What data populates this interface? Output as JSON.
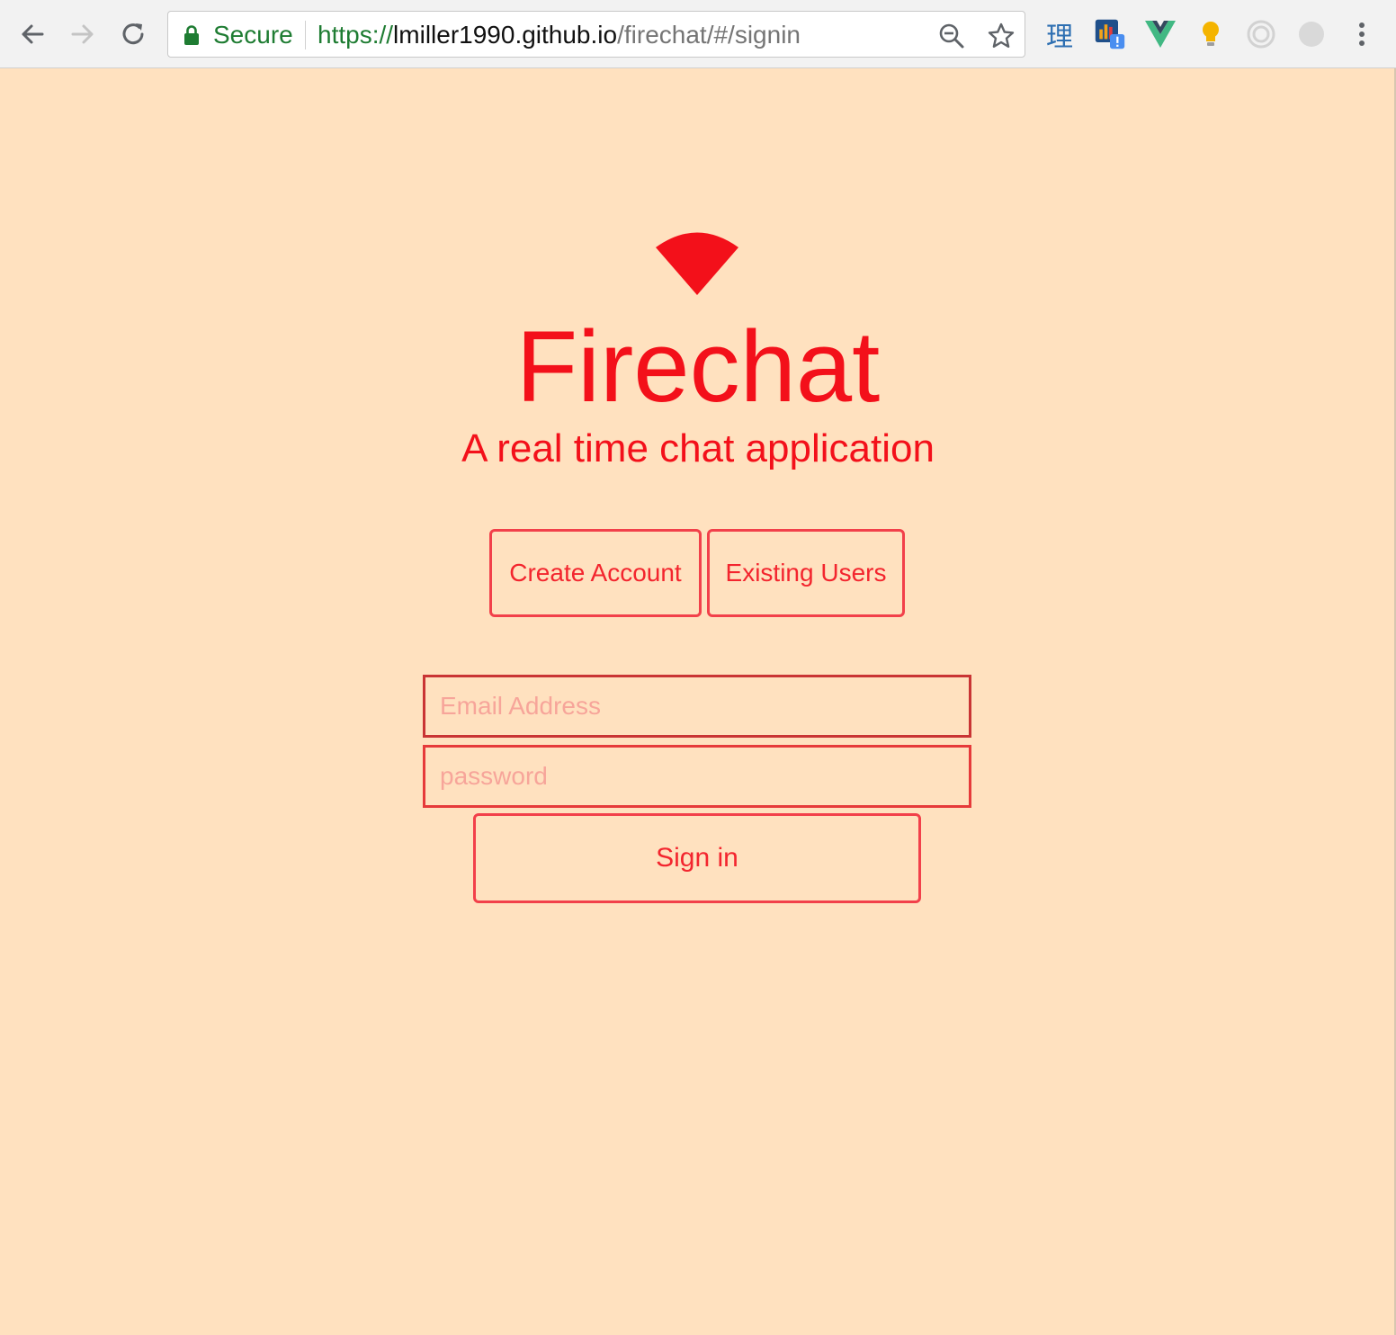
{
  "browser": {
    "secure_label": "Secure",
    "url": {
      "scheme": "https://",
      "host": "lmiller1990.github.io",
      "path": "/firechat/#/signin"
    },
    "extensions": [
      {
        "name": "dictionary-extension",
        "glyph": "理"
      },
      {
        "name": "analytics-extension"
      },
      {
        "name": "vue-devtools-extension"
      },
      {
        "name": "lightbulb-extension"
      },
      {
        "name": "circle-extension"
      },
      {
        "name": "grey-extension"
      }
    ]
  },
  "app": {
    "title": "Firechat",
    "subtitle": "A real time chat application",
    "tabs": {
      "create_account": "Create Account",
      "existing_users": "Existing Users"
    },
    "form": {
      "email_placeholder": "Email Address",
      "password_placeholder": "password",
      "sign_in_label": "Sign in"
    }
  },
  "colors": {
    "background": "#ffe1bf",
    "accent": "#f3101a",
    "border": "#f2404a",
    "placeholder": "#f7a59a"
  }
}
